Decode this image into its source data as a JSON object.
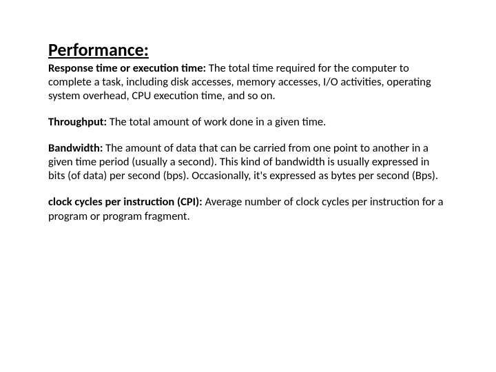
{
  "title": "Performance:",
  "defs": [
    {
      "term": "Response time or execution time: ",
      "body": "The total time required for the computer to complete a task, including disk accesses, memory accesses, I/O activities, operating system overhead, CPU execution time, and so on."
    },
    {
      "term": "Throughput: ",
      "body": "The total amount of work done in a given time."
    },
    {
      "term": "Bandwidth:  ",
      "body": "The amount of data that can be carried from one point to another in a given time period (usually a second). This kind of bandwidth is usually expressed in bits (of data) per second (bps). Occasionally, it's expressed as bytes per second (Bps)."
    },
    {
      "term": "clock cycles per instruction (CPI):  ",
      "body": "Average number of clock cycles per instruction for a program or program fragment."
    }
  ]
}
